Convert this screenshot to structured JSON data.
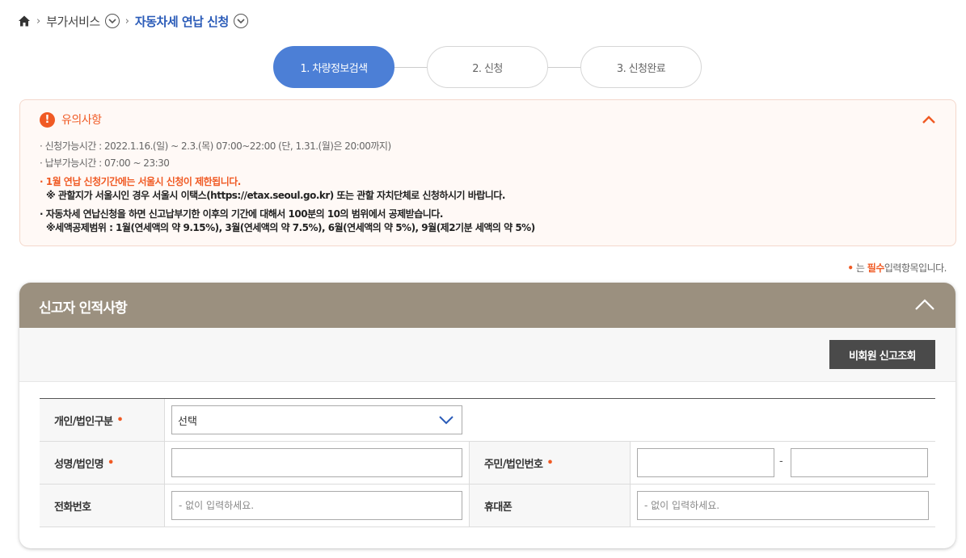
{
  "breadcrumb": {
    "item1": "부가서비스",
    "current": "자동차세 연납 신청"
  },
  "steps": [
    {
      "label": "1. 차량정보검색",
      "active": true
    },
    {
      "label": "2. 신청",
      "active": false
    },
    {
      "label": "3. 신청완료",
      "active": false
    }
  ],
  "notice": {
    "icon": "!",
    "title": "유의사항",
    "lines": [
      "· 신청가능시간 : 2022.1.16.(일) ~ 2.3.(목) 07:00~22:00 (단, 1.31.(월)은 20:00까지)",
      "· 납부가능시간 : 07:00 ~ 23:30",
      "· 1월 연납 신청기간에는 서울시 신청이 제한됩니다.",
      "※ 관할지가 서울시인 경우 서울시 이택스(https://etax.seoul.go.kr) 또는 관할 자치단체로 신청하시기 바랍니다.",
      "· 자동차세 연납신청을 하면 신고납부기한 이후의 기간에 대해서 100분의 10의 범위에서 공제받습니다.",
      "※세액공제범위 : 1월(연세액의 약 9.15%), 3월(연세액의 약 7.5%), 6월(연세액의 약 5%), 9월(제2기분 세액의 약 5%)"
    ]
  },
  "required_note": {
    "dot": "•",
    "prefix": "는",
    "strong": "필수",
    "suffix": "입력항목입니다."
  },
  "panel": {
    "title": "신고자 인적사항",
    "lookup_button": "비회원 신고조회",
    "fields": {
      "type_label": "개인/법인구분",
      "type_value": "선택",
      "name_label": "성명/법인명",
      "idnum_label": "주민/법인번호",
      "idnum_sep": "-",
      "phone_label": "전화번호",
      "phone_placeholder": "- 없이 입력하세요.",
      "mobile_label": "휴대폰",
      "mobile_placeholder": "- 없이 입력하세요.",
      "required_mark": "•"
    }
  },
  "colors": {
    "accent_blue": "#4c7fd6",
    "warning_orange": "#f05a24",
    "panel_header": "#9b907f",
    "button_dark": "#4a4a4a"
  }
}
